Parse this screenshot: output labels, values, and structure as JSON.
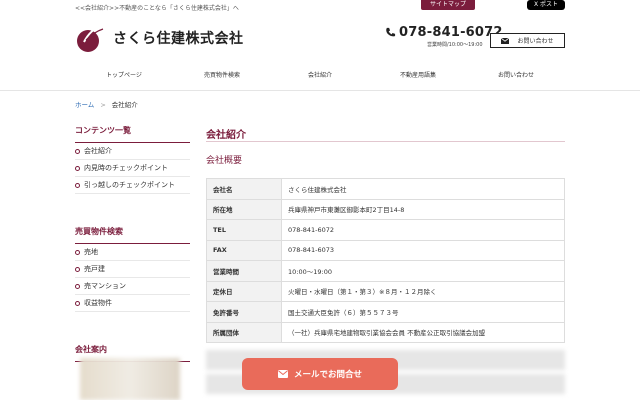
{
  "header": {
    "tagline": "<<会社紹介>>不動産のことなら「さくら住建株式会社」へ",
    "sitemap_label": "サイトマップ",
    "x_post_label": "X ポスト",
    "company_name": "さくら住建株式会社",
    "phone": "078-841-6072",
    "hours": "営業時間/10:00〜19:00",
    "contact_label": "お問い合わせ"
  },
  "nav": [
    "トップページ",
    "売買物件検索",
    "会社紹介",
    "不動産用語集",
    "お問い合わせ"
  ],
  "breadcrumb": {
    "home": "ホーム",
    "separator": ">",
    "current": "会社紹介"
  },
  "sidebar": {
    "contents_title": "コンテンツ一覧",
    "contents": [
      "会社紹介",
      "内見時のチェックポイント",
      "引っ越しのチェックポイント"
    ],
    "search_title": "売買物件検索",
    "search": [
      "売地",
      "売戸建",
      "売マンション",
      "収益物件"
    ],
    "outline_title": "会社案内"
  },
  "main": {
    "title": "会社紹介",
    "subtitle": "会社概要",
    "rows": [
      {
        "label": "会社名",
        "value": "さくら住建株式会社"
      },
      {
        "label": "所在地",
        "value": "兵庫県神戸市東灘区御影本町2丁目14-8"
      },
      {
        "label": "TEL",
        "value": "078-841-6072"
      },
      {
        "label": "FAX",
        "value": "078-841-6073"
      },
      {
        "label": "営業時間",
        "value": "10:00〜19:00"
      },
      {
        "label": "定休日",
        "value": "火曜日・水曜日（第１・第３）※８月・１２月除く"
      },
      {
        "label": "免許番号",
        "value": "国土交通大臣免許（６）第５５７３号"
      },
      {
        "label": "所属団体",
        "value": "（一社）兵庫県宅地建物取引業協会会員 不動産公正取引協議会加盟"
      }
    ]
  },
  "float_button": {
    "label": "メールでお問合せ"
  },
  "colors": {
    "brand": "#7b1d3c",
    "float_button": "#e96b5a",
    "link": "#2f6db5"
  }
}
